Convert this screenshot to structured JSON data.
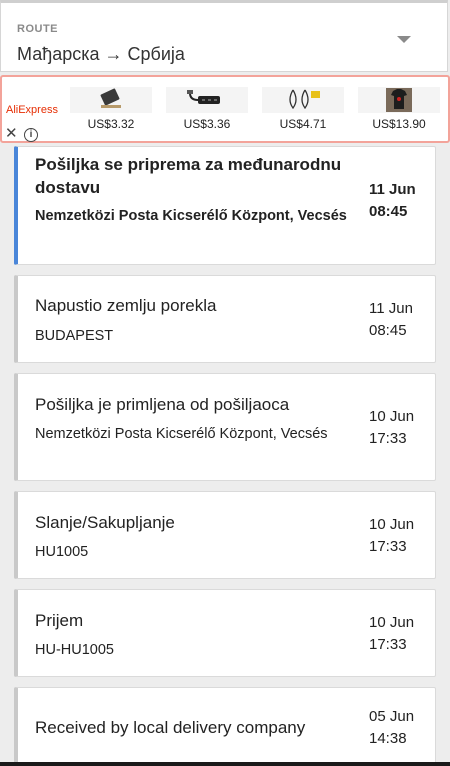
{
  "route": {
    "label": "ROUTE",
    "value": "Мађарска → Србија",
    "dropdown_icon": "chevron-down-icon"
  },
  "ad": {
    "brand": "AliExpress",
    "close_glyph": "✕",
    "info_glyph": "i",
    "products": [
      {
        "price": "US$3.32",
        "icon": "tablet-stand-icon"
      },
      {
        "price": "US$3.36",
        "icon": "usb-hub-icon"
      },
      {
        "price": "US$4.71",
        "icon": "earrings-icon"
      },
      {
        "price": "US$13.90",
        "icon": "tshirt-icon"
      }
    ]
  },
  "events": [
    {
      "title": "Pošiljka se priprema za međunarodnu dostavu",
      "location": "Nemzetközi Posta Kicserélő Központ, Vecsés",
      "date": "11 Jun",
      "time": "08:45",
      "active": true
    },
    {
      "title": "Napustio zemlju porekla",
      "location": "BUDAPEST",
      "date": "11 Jun",
      "time": "08:45",
      "active": false
    },
    {
      "title": "Pošiljka je primljena od pošiljaoca",
      "location": "Nemzetközi Posta Kicserélő Központ, Vecsés",
      "date": "10 Jun",
      "time": "17:33",
      "active": false
    },
    {
      "title": "Slanje/Sakupljanje",
      "location": "HU1005",
      "date": "10 Jun",
      "time": "17:33",
      "active": false
    },
    {
      "title": "Prijem",
      "location": "HU-HU1005",
      "date": "10 Jun",
      "time": "17:33",
      "active": false
    },
    {
      "title": "Received by local  delivery company",
      "location": "",
      "date": "05 Jun",
      "time": "14:38",
      "active": false
    }
  ]
}
